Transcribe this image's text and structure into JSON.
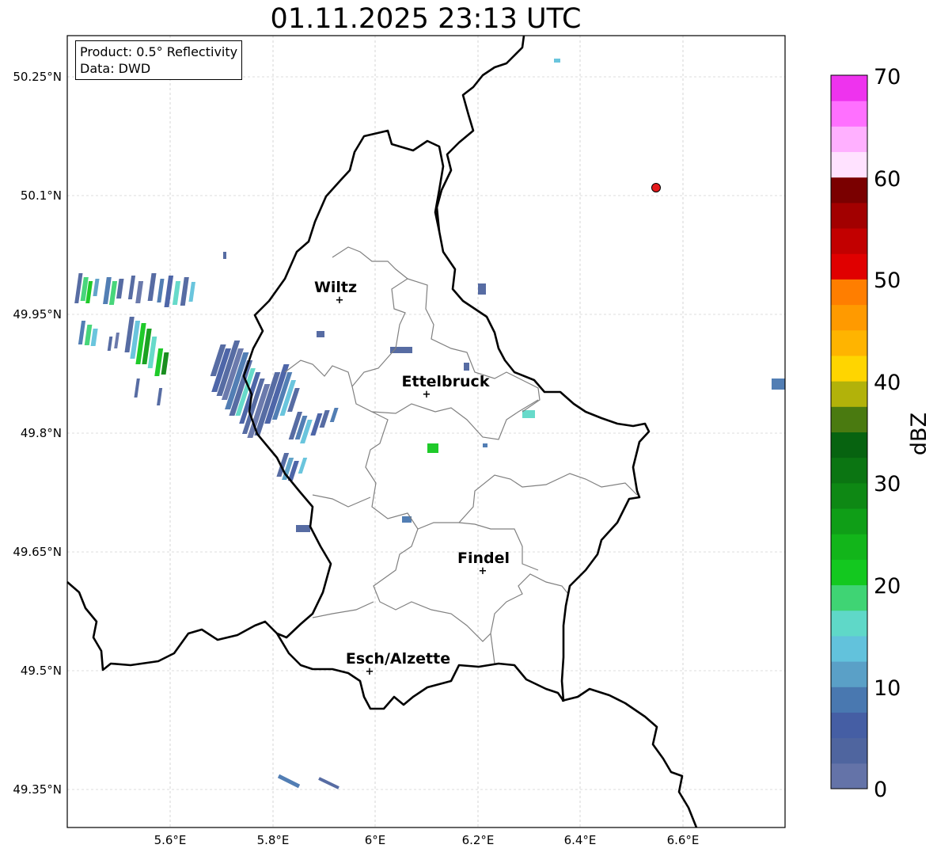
{
  "title": "01.11.2025 23:13 UTC",
  "info": {
    "product": "Product: 0.5° Reflectivity",
    "data": "Data: DWD"
  },
  "axes": {
    "lat_ticks": [
      "50.25°N",
      "50.1°N",
      "49.95°N",
      "49.8°N",
      "49.65°N",
      "49.5°N",
      "49.35°N"
    ],
    "lon_ticks": [
      "5.6°E",
      "5.8°E",
      "6°E",
      "6.2°E",
      "6.4°E",
      "6.6°E"
    ]
  },
  "cities": [
    {
      "name": "Wiltz",
      "lon": 5.93,
      "lat": 49.967
    },
    {
      "name": "Ettelbruck",
      "lon": 6.1,
      "lat": 49.847
    },
    {
      "name": "Findel",
      "lon": 6.21,
      "lat": 49.627
    },
    {
      "name": "Esch/Alzette",
      "lon": 5.99,
      "lat": 49.5
    }
  ],
  "marker": {
    "lon": 6.55,
    "lat": 50.11,
    "color": "#e41a1c"
  },
  "colorbar": {
    "label": "dBZ",
    "ticks": [
      "0",
      "10",
      "20",
      "30",
      "40",
      "50",
      "60",
      "70"
    ],
    "colors": [
      "#6473a8",
      "#4f659f",
      "#455ea4",
      "#4978b0",
      "#5aa0c7",
      "#62c2dc",
      "#5fd8c8",
      "#3fd474",
      "#13c81f",
      "#12b51a",
      "#0f9e17",
      "#0e8814",
      "#0b7512",
      "#076310",
      "#4a7a10",
      "#b2b20a",
      "#ffd500",
      "#ffb400",
      "#ff9a00",
      "#ff7e00",
      "#e00000",
      "#c20000",
      "#a20000",
      "#7a0000",
      "#ffe2ff",
      "#ffb0ff",
      "#ff70ff",
      "#ee33ee"
    ]
  },
  "colors": {
    "border": "#000000",
    "cantons": "#808080",
    "grid": "#bbbbbb"
  }
}
